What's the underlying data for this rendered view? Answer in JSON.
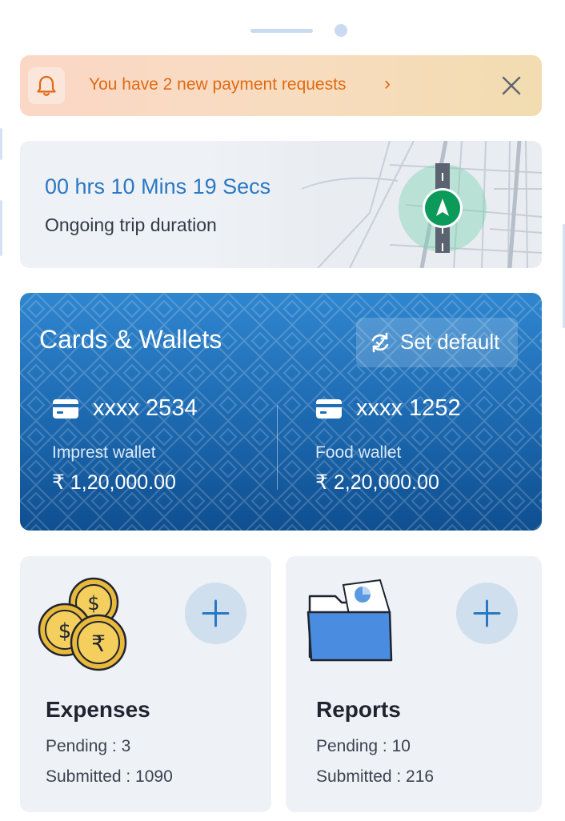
{
  "colors": {
    "accent": "#2a78c4",
    "banner_text": "#e06a12",
    "card_blue": "#1f6db5",
    "tile_bg": "#eef1f5"
  },
  "banner": {
    "icon": "bell-icon",
    "message": "You have 2 new payment requests",
    "chevron": "›",
    "close_icon": "close-icon"
  },
  "trip": {
    "duration": "00 hrs 10 Mins 19 Secs",
    "label": "Ongoing trip duration",
    "map_icon": "navigation-arrow-icon"
  },
  "cards": {
    "title": "Cards & Wallets",
    "set_default_label": "Set default",
    "set_default_icon": "sync-icon",
    "wallets": [
      {
        "number": "xxxx 2534",
        "name": "Imprest wallet",
        "amount": "₹ 1,20,000.00",
        "icon": "card-icon"
      },
      {
        "number": "xxxx 1252",
        "name": "Food wallet",
        "amount": "₹ 2,20,000.00",
        "icon": "card-icon"
      }
    ]
  },
  "tiles": [
    {
      "title": "Expenses",
      "pending": "Pending : 3",
      "submitted": "Submitted : 1090",
      "icon": "coins-icon"
    },
    {
      "title": "Reports",
      "pending": "Pending : 10",
      "submitted": "Submitted : 216",
      "icon": "folder-icon"
    }
  ]
}
